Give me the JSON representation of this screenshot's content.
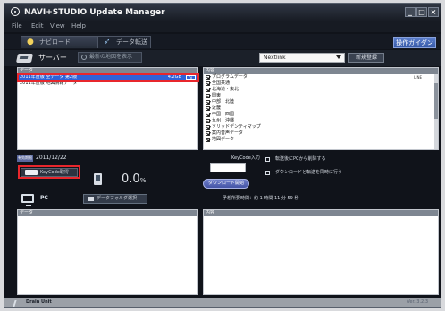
{
  "window": {
    "title": "NAVI+STUDIO  Update Manager",
    "controls": [
      "_",
      "□",
      "×"
    ]
  },
  "menu": [
    "File",
    "Edit",
    "View",
    "Help"
  ],
  "tabs": [
    {
      "label": "ナビロード"
    },
    {
      "label": "データ転送"
    }
  ],
  "header": {
    "server_label": "サーバー",
    "tools_label": "最新の地図を表示",
    "select_value": "Nextlink",
    "register_label": "新規登録",
    "ops_button": "操作ガイダンス"
  },
  "datasets": {
    "header_left": "データ",
    "header_right": "",
    "rows": [
      {
        "name": "2011年度版 全データ 第2版",
        "size": "4.2GB",
        "badge": "DL",
        "selected": true
      },
      {
        "name": "2011年度版 地図情報データ",
        "size": "",
        "badge": "",
        "selected": false
      }
    ]
  },
  "categories": {
    "header_left": "内容",
    "header_right": "",
    "items": [
      {
        "label": "プログラムデータ",
        "checked": true,
        "tag": "LINE"
      },
      {
        "label": "全国共通",
        "checked": true,
        "tag": ""
      },
      {
        "label": "北海道・東北",
        "checked": true,
        "tag": ""
      },
      {
        "label": "関東",
        "checked": true,
        "tag": ""
      },
      {
        "label": "中部・北陸",
        "checked": true,
        "tag": ""
      },
      {
        "label": "近畿",
        "checked": true,
        "tag": ""
      },
      {
        "label": "中国・四国",
        "checked": true,
        "tag": ""
      },
      {
        "label": "九州・沖縄",
        "checked": true,
        "tag": ""
      },
      {
        "label": "ソリッドデンティマップ",
        "checked": true,
        "tag": ""
      },
      {
        "label": "案内音声データ",
        "checked": true,
        "tag": ""
      },
      {
        "label": "地図データ",
        "checked": true,
        "tag": ""
      }
    ]
  },
  "transfer": {
    "date_label": "有効期限",
    "date_value": "2011/12/22",
    "keycode_button": "KeyCode取得",
    "progress": "0.0",
    "progress_unit": "%",
    "keycode_input_label": "KeyCode入力",
    "download_button": "ダウンロード開始",
    "option_1": "転送後にPCから削除する",
    "option_2": "ダウンロードと転送を同時に行う"
  },
  "pc": {
    "label": "PC",
    "folder_button": "データフォルダ選択",
    "time_estimate": "予想所要時間：約 1 時間 11 分 59 秒",
    "left_header": "データ",
    "left_header_right": "",
    "right_header": "内容"
  },
  "status": {
    "drive": "Drain Unit",
    "version": "Ver. 3.2.3"
  }
}
